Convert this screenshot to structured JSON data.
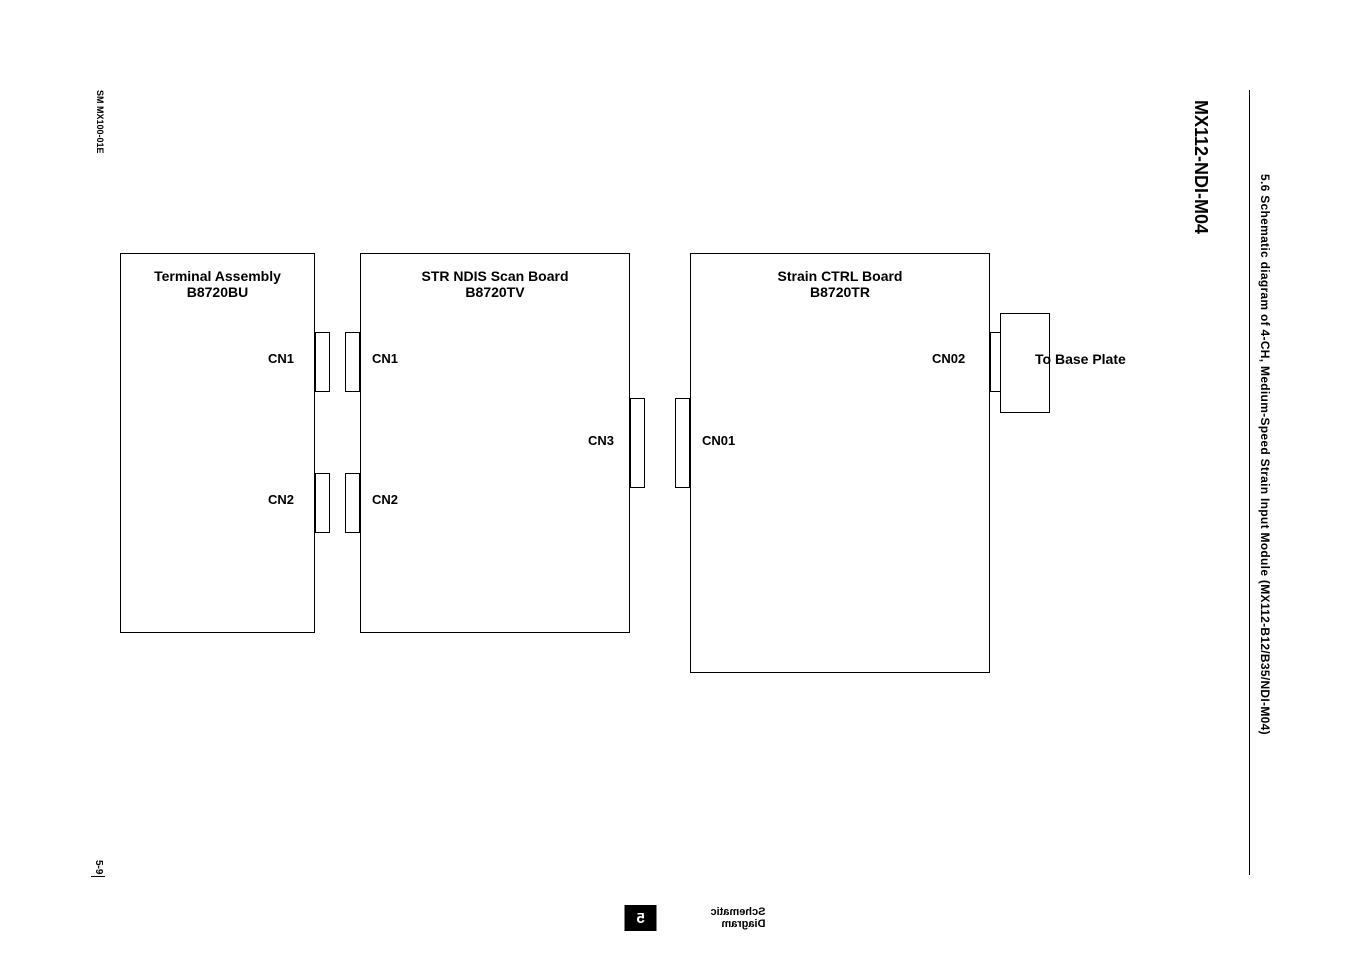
{
  "doc_id": "SM MX100-01E",
  "page_num": "5-9",
  "page_title": "MX112-NDI-M04",
  "section_header": "5.6  Schematic diagram of 4-CH, Medium-Speed Strain Input Module (MX112-B12/B35/NDI-M04)",
  "tab_chapter": "5",
  "tab_label": "Schematic Diagram",
  "diagram": {
    "block1": {
      "title1": "Terminal Assembly",
      "title2": "B8720BU",
      "cn1": "CN1",
      "cn2": "CN2"
    },
    "block2": {
      "title1": "STR NDIS Scan Board",
      "title2": "B8720TV",
      "cn1": "CN1",
      "cn2": "CN2",
      "cn3": "CN3"
    },
    "block3": {
      "title1": "Strain CTRL Board",
      "title2": "B8720TR",
      "cn01": "CN01",
      "cn02": "CN02"
    },
    "base_plate": "To Base Plate"
  }
}
